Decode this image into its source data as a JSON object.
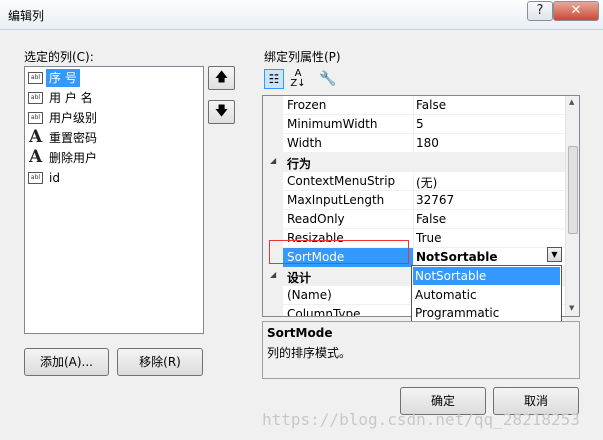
{
  "window": {
    "title": "编辑列",
    "help_label": "?",
    "close_label": "✕"
  },
  "columns_panel": {
    "label": "选定的列(C):",
    "items": [
      {
        "icon": "textbox-column-icon",
        "label": "序 号",
        "selected": true
      },
      {
        "icon": "textbox-column-icon",
        "label": "用 户 名"
      },
      {
        "icon": "textbox-column-icon",
        "label": "用户级别"
      },
      {
        "icon": "link-column-icon",
        "label": "重置密码"
      },
      {
        "icon": "link-column-icon",
        "label": "删除用户"
      },
      {
        "icon": "textbox-column-icon",
        "label": "id"
      }
    ],
    "move_up_label": "🡅",
    "move_down_label": "🡇",
    "add_label": "添加(A)...",
    "remove_label": "移除(R)"
  },
  "properties_panel": {
    "label": "绑定列属性(P)",
    "rows": [
      {
        "name": "Frozen",
        "value": "False"
      },
      {
        "name": "MinimumWidth",
        "value": "5"
      },
      {
        "name": "Width",
        "value": "180"
      }
    ],
    "category_behavior": "行为",
    "behavior_rows": [
      {
        "name": "ContextMenuStrip",
        "value": "(无)"
      },
      {
        "name": "MaxInputLength",
        "value": "32767"
      },
      {
        "name": "ReadOnly",
        "value": "False"
      },
      {
        "name": "Resizable",
        "value": "True"
      },
      {
        "name": "SortMode",
        "value": "NotSortable"
      }
    ],
    "category_design": "设计",
    "design_rows": [
      {
        "name": "(Name)",
        "value": ""
      },
      {
        "name": "ColumnType",
        "value": ""
      }
    ],
    "dropdown_options": [
      "NotSortable",
      "Automatic",
      "Programmatic"
    ],
    "description_title": "SortMode",
    "description_text": "列的排序模式。"
  },
  "footer": {
    "ok_label": "确定",
    "cancel_label": "取消"
  },
  "watermark": "https://blog.csdn.net/qq_28218253"
}
